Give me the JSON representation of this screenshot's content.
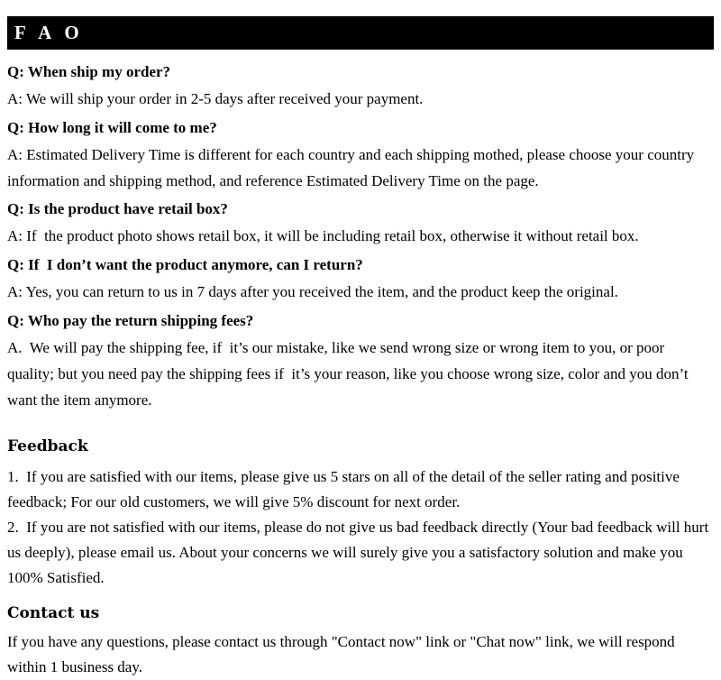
{
  "banner": {
    "title": "F A O"
  },
  "faq": {
    "items": [
      {
        "question": "Q: When ship my order?",
        "answer": "A: We will ship your order in 2-5 days after received your payment."
      },
      {
        "question": "Q: How long it will come to me?",
        "answer": "A: Estimated Delivery Time is different for each country and each shipping mothed, please choose your country information and shipping method, and reference Estimated Delivery Time on the page."
      },
      {
        "question": "Q: Is the product have retail box?",
        "answer": "A: If  the product photo shows retail box, it will be including retail box, otherwise it without retail box."
      },
      {
        "question": "Q: If  I don’t want the product anymore, can I return?",
        "answer": "A: Yes, you can return to us in 7 days after you received the item, and the product keep the original."
      },
      {
        "question": "Q: Who pay the return shipping fees?",
        "answer": "A.  We will pay the shipping fee, if  it’s our mistake, like we send wrong size or wrong item to you, or poor quality; but you need pay the shipping fees if  it’s your reason, like you choose wrong size, color and you don’t want the item anymore."
      }
    ]
  },
  "feedback": {
    "heading": "Feedback",
    "paragraphs": [
      "1.  If you are satisfied with our items, please give us 5 stars on all of the detail of the seller rating and positive feedback; For our old customers, we will give 5% discount for next order.",
      "2.  If you are not satisfied with our items, please do not give us bad feedback directly (Your bad feedback will hurt us deeply), please email us. About your concerns we will surely give you a satisfactory solution and make you 100% Satisfied."
    ]
  },
  "contact": {
    "heading": "Contact us",
    "paragraphs": [
      "If you have any questions, please contact us through \"Contact now\" link or \"Chat now\" link, we will respond within 1 business day."
    ]
  },
  "colors": {
    "banner_background": "#000000",
    "banner_text": "#ffffff",
    "page_background": "#ffffff",
    "body_text": "#000000"
  }
}
